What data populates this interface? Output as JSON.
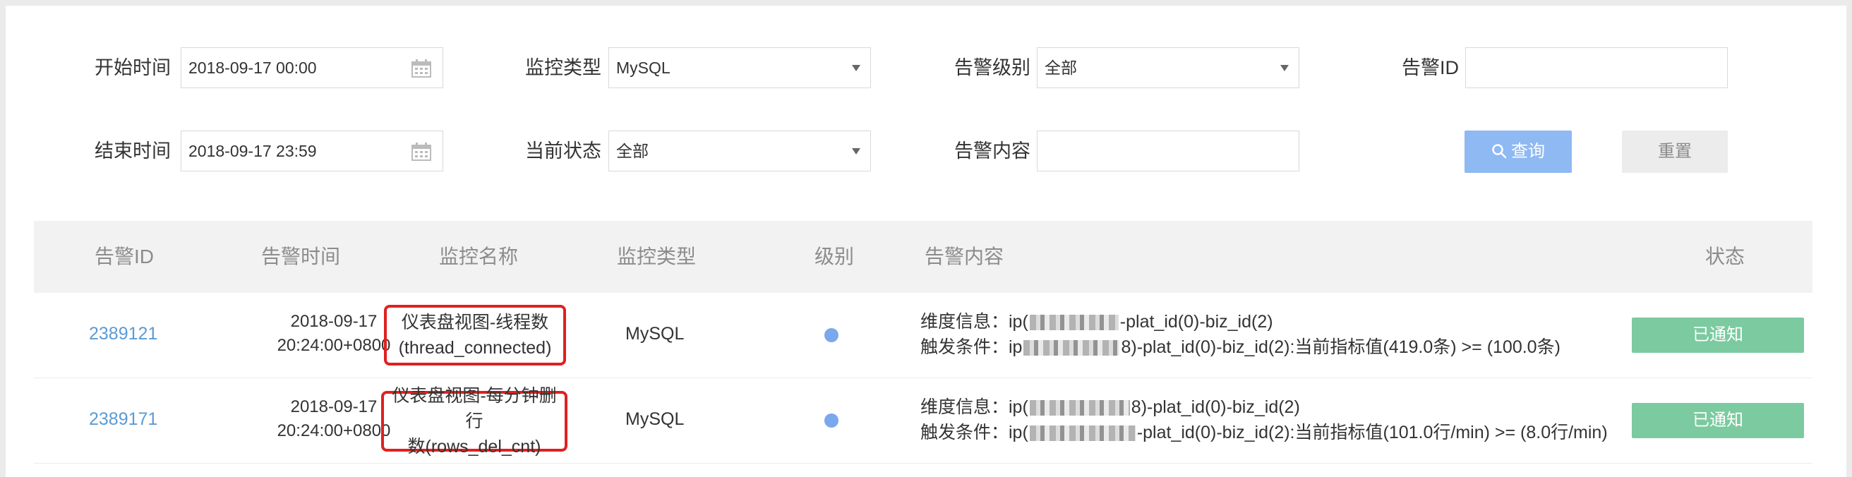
{
  "filters": {
    "start_time": {
      "label": "开始时间",
      "value": "2018-09-17 00:00"
    },
    "end_time": {
      "label": "结束时间",
      "value": "2018-09-17 23:59"
    },
    "monitor_type": {
      "label": "监控类型",
      "value": "MySQL"
    },
    "current_status": {
      "label": "当前状态",
      "value": "全部"
    },
    "alert_level": {
      "label": "告警级别",
      "value": "全部"
    },
    "alert_content": {
      "label": "告警内容",
      "value": ""
    },
    "alert_id": {
      "label": "告警ID",
      "value": ""
    },
    "query_label": "查询",
    "reset_label": "重置"
  },
  "table": {
    "columns": [
      "告警ID",
      "告警时间",
      "监控名称",
      "监控类型",
      "级别",
      "告警内容",
      "状态"
    ],
    "rows": [
      {
        "id": "2389121",
        "time_date": "2018-09-17",
        "time_clock": "20:24:00+0800",
        "monitor_name_1": "仪表盘视图-线程数",
        "monitor_name_2": "(thread_connected)",
        "monitor_type": "MySQL",
        "level_color": "#7aa8ec",
        "content_l1_prefix": "维度信息：ip(",
        "content_l1_suffix": "-plat_id(0)-biz_id(2)",
        "content_l2_prefix": "触发条件：ip",
        "content_l2_suffix": "8)-plat_id(0)-biz_id(2):当前指标值(419.0条) >= (100.0条)",
        "status": "已通知"
      },
      {
        "id": "2389171",
        "time_date": "2018-09-17",
        "time_clock": "20:24:00+0800",
        "monitor_name_1": "仪表盘视图-每分钟删行",
        "monitor_name_2": "数(rows_del_cnt)",
        "monitor_type": "MySQL",
        "level_color": "#7aa8ec",
        "content_l1_prefix": "维度信息：ip(",
        "content_l1_suffix": "8)-plat_id(0)-biz_id(2)",
        "content_l2_prefix": "触发条件：ip(",
        "content_l2_suffix": "-plat_id(0)-biz_id(2):当前指标值(101.0行/min) >= (8.0行/min)",
        "status": "已通知"
      }
    ]
  },
  "icons": {
    "calendar": "calendar-icon",
    "search": "search-icon",
    "dropdown": "chevron-down-icon"
  },
  "colors": {
    "link": "#5b9bd5",
    "highlight_box": "#e02020",
    "status_badge": "#7ccaa0",
    "query_button": "#8fb9f2"
  }
}
